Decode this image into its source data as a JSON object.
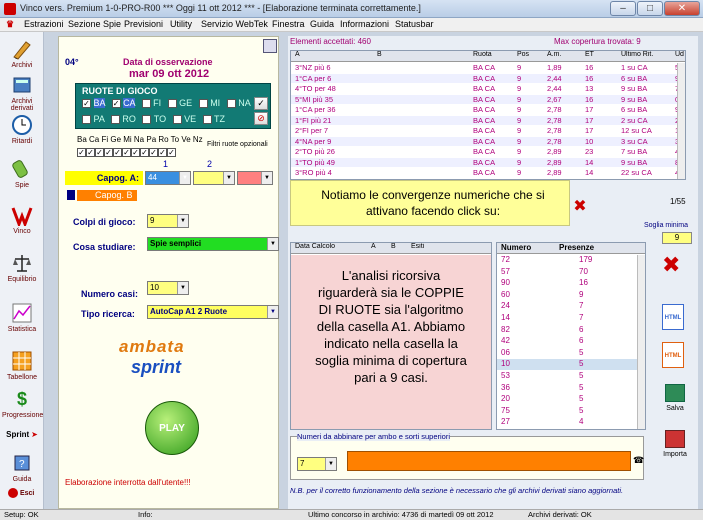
{
  "window": {
    "title": "Vinco vers. Premium  1-0-PRO-R00  ***  Oggi 11 ott 2012  ***  - [Elaborazione terminata correttamente.]"
  },
  "menu": [
    "Estrazioni",
    "Sezione Spie",
    "Previsioni",
    "Utility",
    "Servizio WebTek",
    "Finestra",
    "Guida",
    "Informazioni",
    "Statusbar"
  ],
  "sidebar": [
    "Archivi",
    "Archivi derivati",
    "Ritardi",
    "Spie",
    "Vinco",
    "Equilibrio",
    "Statistica",
    "Tabellone",
    "Progressione",
    "Sprint",
    "Guida",
    "Esci"
  ],
  "left": {
    "temp": "04°",
    "obs_label": "Data di osservazione",
    "obs_date": "mar 09 ott 2012",
    "ruote_title": "RUOTE DI GIOCO",
    "ruote_row1": [
      "BA",
      "CA",
      "FI",
      "GE",
      "MI",
      "NA"
    ],
    "ruote_row2": [
      "PA",
      "RO",
      "TO",
      "VE",
      "TZ"
    ],
    "abbr": "Ba Ca Fi Ge Mi Na Pa Ro To Ve Nz",
    "filtri": "Filtri ruote opzionali",
    "col1": "1",
    "col2": "2",
    "capoA": "Capog. A:",
    "capoA_val": "44",
    "capoB": "Capog. B",
    "colpi_label": "Colpi di gioco:",
    "colpi_val": "9",
    "cosa_label": "Cosa studiare:",
    "cosa_val": "Spie semplici",
    "num_label": "Numero casi:",
    "num_val": "10",
    "tipo_label": "Tipo ricerca:",
    "tipo_val": "AutoCap A1 2 Ruote",
    "logo1": "ambata",
    "logo2": "sprint",
    "play": "PLAY",
    "interrupted": "Elaborazione interrotta dall'utente!!!"
  },
  "top": {
    "accepted": "Elementi accettati: 460",
    "max": "Max copertura trovata:  9",
    "headers": [
      "A",
      "B",
      "Ruota",
      "Pos",
      "A.m.",
      "ET",
      "Ultimo Rit.",
      "Ud"
    ],
    "rows": [
      [
        "3°NZ  più 6",
        "BA CA",
        "9",
        "1,89",
        "16",
        "1 su CA",
        "5"
      ],
      [
        "1°CA  per 6",
        "BA CA",
        "9",
        "2,44",
        "16",
        "6 su BA",
        "9"
      ],
      [
        "4°TO  per 48",
        "BA CA",
        "9",
        "2,44",
        "13",
        "9 su BA",
        "7"
      ],
      [
        "5°MI  più 35",
        "BA CA",
        "9",
        "2,67",
        "16",
        "9 su BA",
        "0"
      ],
      [
        "1°CA  per 36",
        "BA CA",
        "9",
        "2,78",
        "17",
        "6 su BA",
        "9"
      ],
      [
        "1°FI  più 21",
        "BA CA",
        "9",
        "2,78",
        "17",
        "2 su CA",
        "2"
      ],
      [
        "2°FI  per 7",
        "BA CA",
        "9",
        "2,78",
        "17",
        "12 su CA",
        "1"
      ],
      [
        "4°NA  per 9",
        "BA CA",
        "9",
        "2,78",
        "10",
        "3 su CA",
        "3"
      ],
      [
        "2°TO  più 26",
        "BA CA",
        "9",
        "2,89",
        "23",
        "7 su BA",
        "4"
      ],
      [
        "1°TO  più 49",
        "BA CA",
        "9",
        "2,89",
        "14",
        "9 su BA",
        "8"
      ],
      [
        "3°RO  più 4",
        "BA CA",
        "9",
        "2,89",
        "14",
        "22 su CA",
        "4"
      ]
    ]
  },
  "note1": "Notiamo le convergenze numeriche che si attivano facendo click su:",
  "side_vals": {
    "ratio": "1/55",
    "soglia": "Soglia minima",
    "soglia_val": "9"
  },
  "bottom": {
    "headers": [
      "Data Calcolo",
      "A",
      "B",
      "Esiti"
    ],
    "note2": "L'analisi ricorsiva riguarderà sia le COPPIE DI RUOTE sia l'algoritmo della casella A1. Abbiamo indicato nella casella la soglia minima di copertura pari a 9 casi.",
    "num_headers": [
      "Numero",
      "Presenze"
    ],
    "nums": [
      [
        "72",
        "179"
      ],
      [
        "57",
        "70"
      ],
      [
        "90",
        "16"
      ],
      [
        "60",
        "9"
      ],
      [
        "24",
        "7"
      ],
      [
        "14",
        "7"
      ],
      [
        "82",
        "6"
      ],
      [
        "42",
        "6"
      ],
      [
        "06",
        "5"
      ],
      [
        "10",
        "5"
      ],
      [
        "53",
        "5"
      ],
      [
        "36",
        "5"
      ],
      [
        "20",
        "5"
      ],
      [
        "75",
        "5"
      ],
      [
        "27",
        "4"
      ]
    ]
  },
  "abbinare": {
    "title": "Numeri da abbinare per ambo e sorti superiori",
    "val": "7"
  },
  "nb": "N.B. per il corretto funzionamento della sezione è necessario che gli archivi derivati siano aggiornati.",
  "right_tools": [
    "Salva",
    "Importa"
  ],
  "status": {
    "setup": "Setup: OK",
    "info": "Info:",
    "last": "Ultimo concorso in archivio: 4736 di martedì 09 ott 2012",
    "derived": "Archivi derivati: OK"
  },
  "colors": {
    "accent": "#ff8000",
    "row_text": "#b0007c",
    "note_yellow": "#ffff99",
    "note_pink": "#f7d4d4"
  }
}
